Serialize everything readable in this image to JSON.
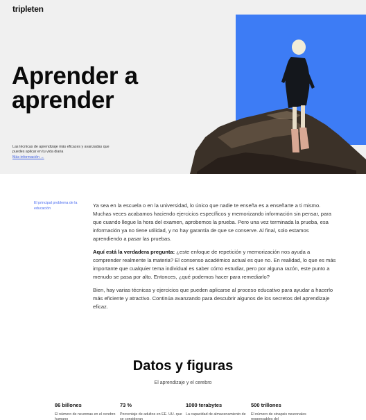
{
  "header": {
    "logo_text": "tripleten"
  },
  "hero": {
    "title_line1": "Aprender a",
    "title_line2": "aprender",
    "description": "Las técnicas de aprendizaje más eficaces y avanzadas que puedes aplicar en tu vida diaria",
    "link_label": "Más información →",
    "accent_color": "#3d7cf5"
  },
  "article": {
    "side_note": "El principal problema de la educación",
    "p1": "Ya sea en la escuela o en la universidad, lo único que nadie te enseña es a enseñarte a ti mismo. Muchas veces acabamos haciendo ejercicios específicos y memorizando información sin pensar, para que cuando llegue la hora del examen, aprobemos la prueba. Pero una vez terminada la prueba, esa información ya no tiene utilidad, y no hay garantía de que se conserve. Al final, solo estamos aprendiendo a pasar las pruebas.",
    "p2_bold": "Aquí está la verdadera pregunta:",
    "p2_rest": " ¿este enfoque de repetición y memorización nos ayuda a comprender realmente la materia? El consenso académico actual es que no. En realidad, lo que es más importante que cualquier tema individual es saber cómo estudiar, pero por alguna razón, este punto a menudo se pasa por alto. Entonces, ¿qué podemos hacer para remediarlo?",
    "p3": "Bien, hay varias técnicas y ejercicios que pueden aplicarse al proceso educativo para ayudar a hacerlo más eficiente y atractivo. Continúa avanzando para descubrir algunos de los secretos del aprendizaje eficaz."
  },
  "stats": {
    "title": "Datos y figuras",
    "subtitle": "El aprendizaje y el cerebro",
    "items": [
      {
        "value": "86 billones",
        "desc": "El número de neuronas en el cerebro humano"
      },
      {
        "value": "73 %",
        "desc": "Porcentaje de adultos en EE. UU. que se consideran"
      },
      {
        "value": "1000 terabytes",
        "desc": "La capacidad de almacenamiento de"
      },
      {
        "value": "500 trillones",
        "desc": "El número de sinapsis neuronales responsables del"
      }
    ]
  }
}
